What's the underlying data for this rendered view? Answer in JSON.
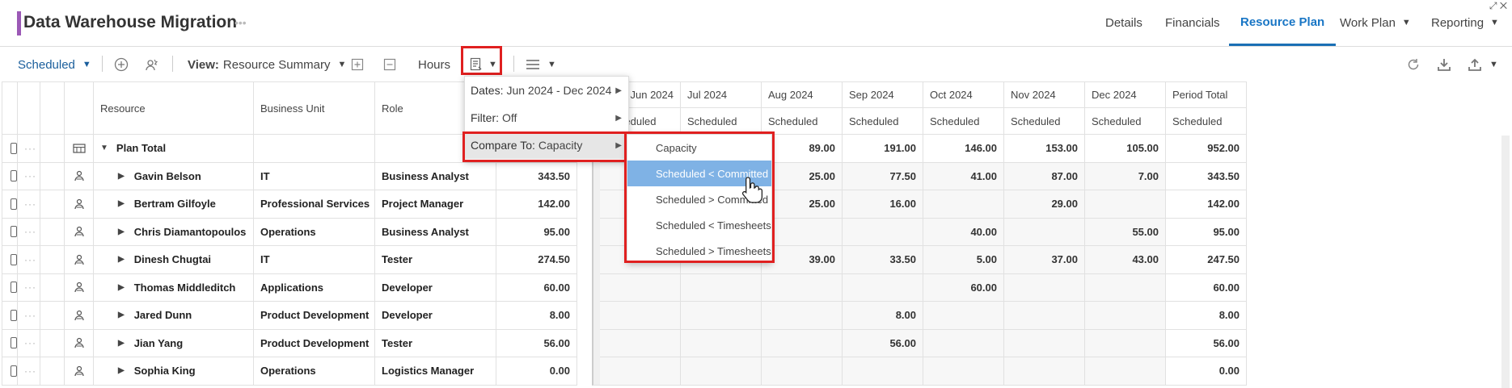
{
  "header": {
    "title": "Data Warehouse Migration",
    "title_more": "•••",
    "nav": [
      {
        "label": "Details",
        "active": false,
        "caret": false
      },
      {
        "label": "Financials",
        "active": false,
        "caret": false
      },
      {
        "label": "Resource Plan",
        "active": true,
        "caret": false
      },
      {
        "label": "Work Plan",
        "active": false,
        "caret": true
      },
      {
        "label": "Reporting",
        "active": false,
        "caret": true
      }
    ]
  },
  "toolbar": {
    "scheduled_label": "Scheduled",
    "view_prefix": "View:",
    "view_value": "Resource Summary",
    "hours_label": "Hours"
  },
  "grid": {
    "columns": {
      "resource": "Resource",
      "business_unit": "Business Unit",
      "role": "Role"
    },
    "months": [
      "Jun 2024",
      "Jul 2024",
      "Aug 2024",
      "Sep 2024",
      "Oct 2024",
      "Nov 2024",
      "Dec 2024",
      "Period Total"
    ],
    "sub_header": "Scheduled",
    "total_row": {
      "label": "Plan Total",
      "values": [
        "",
        "",
        "89.00",
        "191.00",
        "146.00",
        "153.00",
        "105.00",
        "952.00"
      ]
    },
    "rows": [
      {
        "name": "Gavin Belson",
        "unit": "IT",
        "role": "Business Analyst",
        "total": "343.50",
        "cells": [
          {
            "v": "",
            "c": "green"
          },
          {
            "v": "",
            "c": "green"
          },
          {
            "v": "25.00",
            "c": "green"
          },
          {
            "v": "77.50",
            "c": "red"
          },
          {
            "v": "41.00",
            "c": "green"
          },
          {
            "v": "87.00",
            "c": "green"
          },
          {
            "v": "7.00",
            "c": "green"
          },
          {
            "v": "343.50",
            "c": ""
          }
        ]
      },
      {
        "name": "Bertram Gilfoyle",
        "unit": "Professional Services",
        "role": "Project Manager",
        "total": "142.00",
        "cells": [
          {
            "v": "",
            "c": "red"
          },
          {
            "v": "",
            "c": "green"
          },
          {
            "v": "25.00",
            "c": "green"
          },
          {
            "v": "16.00",
            "c": "green"
          },
          {
            "v": "",
            "c": ""
          },
          {
            "v": "29.00",
            "c": "green"
          },
          {
            "v": "",
            "c": ""
          },
          {
            "v": "142.00",
            "c": ""
          }
        ]
      },
      {
        "name": "Chris Diamantopoulos",
        "unit": "Operations",
        "role": "Business Analyst",
        "total": "95.00",
        "cells": [
          {
            "v": "",
            "c": ""
          },
          {
            "v": "",
            "c": ""
          },
          {
            "v": "",
            "c": ""
          },
          {
            "v": "",
            "c": ""
          },
          {
            "v": "40.00",
            "c": "green"
          },
          {
            "v": "",
            "c": ""
          },
          {
            "v": "55.00",
            "c": "green"
          },
          {
            "v": "95.00",
            "c": ""
          }
        ]
      },
      {
        "name": "Dinesh Chugtai",
        "unit": "IT",
        "role": "Tester",
        "total": "274.50",
        "cells": [
          {
            "v": "",
            "c": ""
          },
          {
            "v": "",
            "c": "green"
          },
          {
            "v": "39.00",
            "c": "green"
          },
          {
            "v": "33.50",
            "c": "green"
          },
          {
            "v": "5.00",
            "c": "green"
          },
          {
            "v": "37.00",
            "c": "green"
          },
          {
            "v": "43.00",
            "c": "green"
          },
          {
            "v": "247.50",
            "c": ""
          }
        ]
      },
      {
        "name": "Thomas Middleditch",
        "unit": "Applications",
        "role": "Developer",
        "total": "60.00",
        "cells": [
          {
            "v": "",
            "c": ""
          },
          {
            "v": "",
            "c": ""
          },
          {
            "v": "",
            "c": ""
          },
          {
            "v": "",
            "c": ""
          },
          {
            "v": "60.00",
            "c": "green"
          },
          {
            "v": "",
            "c": ""
          },
          {
            "v": "",
            "c": ""
          },
          {
            "v": "60.00",
            "c": ""
          }
        ]
      },
      {
        "name": "Jared Dunn",
        "unit": "Product Development",
        "role": "Developer",
        "total": "8.00",
        "cells": [
          {
            "v": "",
            "c": ""
          },
          {
            "v": "",
            "c": ""
          },
          {
            "v": "",
            "c": ""
          },
          {
            "v": "8.00",
            "c": "red"
          },
          {
            "v": "",
            "c": ""
          },
          {
            "v": "",
            "c": ""
          },
          {
            "v": "",
            "c": ""
          },
          {
            "v": "8.00",
            "c": ""
          }
        ]
      },
      {
        "name": "Jian Yang",
        "unit": "Product Development",
        "role": "Tester",
        "total": "56.00",
        "cells": [
          {
            "v": "",
            "c": ""
          },
          {
            "v": "",
            "c": ""
          },
          {
            "v": "",
            "c": ""
          },
          {
            "v": "56.00",
            "c": "amber"
          },
          {
            "v": "",
            "c": ""
          },
          {
            "v": "",
            "c": ""
          },
          {
            "v": "",
            "c": ""
          },
          {
            "v": "56.00",
            "c": ""
          }
        ]
      },
      {
        "name": "Sophia King",
        "unit": "Operations",
        "role": "Logistics Manager",
        "total": "0.00",
        "cells": [
          {
            "v": "",
            "c": ""
          },
          {
            "v": "",
            "c": ""
          },
          {
            "v": "",
            "c": ""
          },
          {
            "v": "",
            "c": ""
          },
          {
            "v": "",
            "c": ""
          },
          {
            "v": "",
            "c": ""
          },
          {
            "v": "",
            "c": ""
          },
          {
            "v": "0.00",
            "c": ""
          }
        ]
      }
    ]
  },
  "menu": {
    "dates_label": "Dates:",
    "dates_value": "Jun 2024 - Dec 2024",
    "filter_label": "Filter:",
    "filter_value": "Off",
    "compare_label": "Compare To:",
    "compare_value": "Capacity"
  },
  "submenu": {
    "items": [
      "Capacity",
      "Scheduled < Committed",
      "Scheduled > Committed",
      "Scheduled < Timesheets",
      "Scheduled > Timesheets"
    ],
    "selected_index": 1
  },
  "colors": {
    "accent": "#1976c5",
    "green": "#2dbb76",
    "red": "#f36f68",
    "amber": "#ffc000",
    "highlight": "#e02020"
  }
}
